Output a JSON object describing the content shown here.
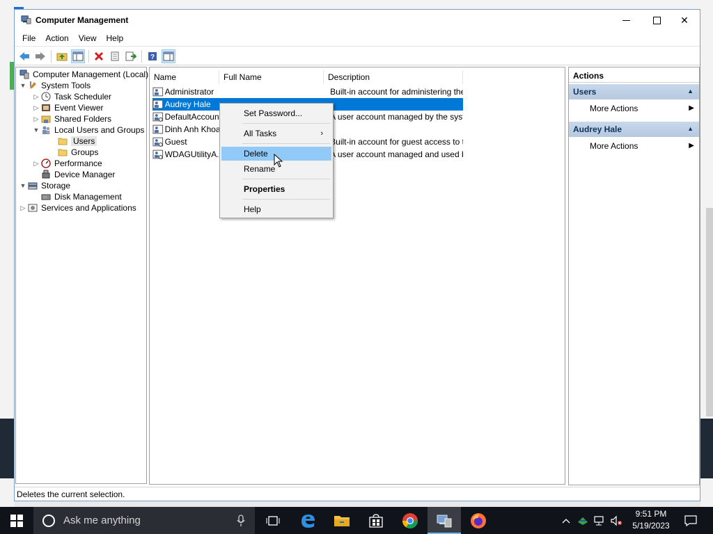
{
  "window": {
    "title": "Computer Management",
    "min_glyph": "",
    "close_glyph": "✕"
  },
  "menu": [
    "File",
    "Action",
    "View",
    "Help"
  ],
  "tree": {
    "root": "Computer Management (Local)",
    "system_tools": "System Tools",
    "task_scheduler": "Task Scheduler",
    "event_viewer": "Event Viewer",
    "shared_folders": "Shared Folders",
    "local_users_groups": "Local Users and Groups",
    "users": "Users",
    "groups": "Groups",
    "performance": "Performance",
    "device_manager": "Device Manager",
    "storage": "Storage",
    "disk_management": "Disk Management",
    "services_apps": "Services and Applications"
  },
  "list": {
    "columns": [
      "Name",
      "Full Name",
      "Description"
    ],
    "rows": [
      {
        "name": "Administrator",
        "full": "",
        "desc": "Built-in account for administering the ..."
      },
      {
        "name": "Audrey Hale",
        "full": "",
        "desc": ""
      },
      {
        "name": "DefaultAccount",
        "full": "",
        "desc": "A user account managed by the syst..."
      },
      {
        "name": "Dinh Anh Khoa",
        "full": "",
        "desc": ""
      },
      {
        "name": "Guest",
        "full": "",
        "desc": "Built-in account for guest access to th..."
      },
      {
        "name": "WDAGUtilityA...",
        "full": "",
        "desc": "A user account managed and used b..."
      }
    ]
  },
  "context_menu": {
    "set_password": "Set Password...",
    "all_tasks": "All Tasks",
    "delete": "Delete",
    "rename": "Rename",
    "properties": "Properties",
    "help": "Help"
  },
  "actions": {
    "header": "Actions",
    "section1": "Users",
    "more1": "More Actions",
    "section2": "Audrey Hale",
    "more2": "More Actions"
  },
  "status": "Deletes the current selection.",
  "taskbar": {
    "search_placeholder": "Ask me anything",
    "time": "9:51 PM",
    "date": "5/19/2023"
  },
  "colors": {
    "selection": "#0078d7",
    "menu_highlight": "#91c9f7",
    "taskbar": "#101319"
  }
}
